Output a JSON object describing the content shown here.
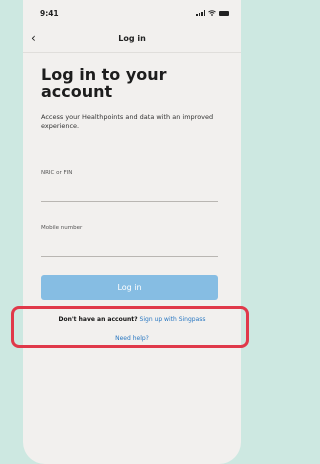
{
  "status_bar": {
    "time": "9:41"
  },
  "nav": {
    "title": "Log in",
    "back_icon": "chevron-left-icon"
  },
  "heading": "Log in to your account",
  "subtext": "Access your Healthpoints and data with an improved experience.",
  "fields": {
    "nric": {
      "label": "NRIC or FIN",
      "value": ""
    },
    "mobile": {
      "label": "Mobile number",
      "value": ""
    }
  },
  "login_button": {
    "label": "Log in"
  },
  "signup": {
    "question": "Don't have an account?",
    "link": "Sign up with Singpass"
  },
  "help": {
    "link": "Need help?"
  },
  "colors": {
    "background": "#cde8e1",
    "screen": "#f2f0ee",
    "button": "#86bde3",
    "link": "#2a78c2",
    "highlight": "#e0394a"
  }
}
